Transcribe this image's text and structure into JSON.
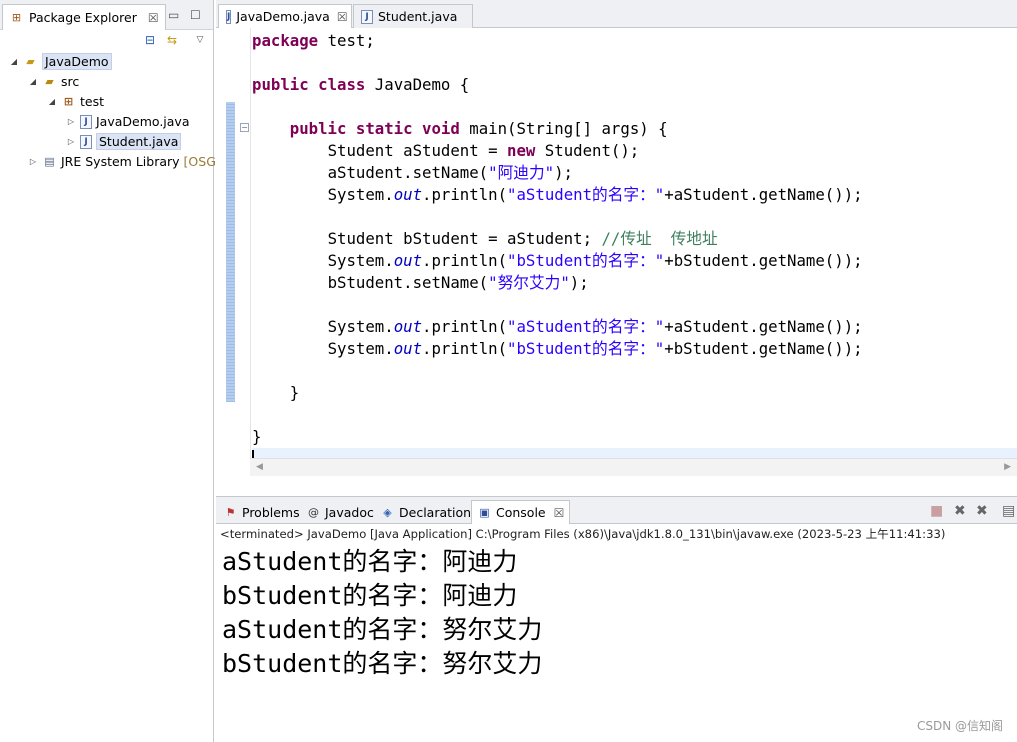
{
  "package_explorer": {
    "title": "Package Explorer",
    "close": "☒",
    "tree": {
      "project": "JavaDemo",
      "src": "src",
      "package": "test",
      "files": [
        "JavaDemo.java",
        "Student.java"
      ],
      "jre": "JRE System Library",
      "jre_decoration": "[OSGi"
    }
  },
  "editor": {
    "tabs": [
      {
        "label": "JavaDemo.java",
        "close": "☒"
      },
      {
        "label": "Student.java"
      }
    ],
    "code": {
      "l1_kw": "package",
      "l1_rest": " test;",
      "l3_kw1": "public",
      "l3_kw2": "class",
      "l3_rest": " JavaDemo {",
      "l5_kw1": "public",
      "l5_kw2": "static",
      "l5_kw3": "void",
      "l5_rest": " main(String[] args) {",
      "l6_a": "Student aStudent = ",
      "l6_kw": "new",
      "l6_b": " Student();",
      "l7_a": "aStudent.setName(",
      "l7_str": "\"阿迪力\"",
      "l7_b": ");",
      "sys": "System.",
      "out": "out",
      "println": ".println(",
      "l8_str": "\"aStudent的名字：\"",
      "l8_b": "+aStudent.getName());",
      "l10_a": "Student bStudent = aStudent; ",
      "l10_cmt": "//传址  传地址",
      "l11_str": "\"bStudent的名字：\"",
      "l11_b": "+bStudent.getName());",
      "l12_a": "bStudent.setName(",
      "l12_str": "\"努尔艾力\"",
      "l12_b": ");",
      "l14_str": "\"aStudent的名字：\"",
      "l14_b": "+aStudent.getName());",
      "l15_str": "\"bStudent的名字：\"",
      "l15_b": "+bStudent.getName());",
      "close_brace": "}"
    }
  },
  "bottom": {
    "tabs": [
      "Problems",
      "Javadoc",
      "Declaration",
      "Console"
    ],
    "console_close": "☒",
    "terminated": "<terminated> JavaDemo [Java Application] C:\\Program Files (x86)\\Java\\jdk1.8.0_131\\bin\\javaw.exe (2023-5-23 上午11:41:33)",
    "output": [
      "aStudent的名字：阿迪力",
      "bStudent的名字：阿迪力",
      "aStudent的名字：努尔艾力",
      "bStudent的名字：努尔艾力"
    ]
  },
  "watermark": "CSDN @信知阁",
  "colors": {
    "keyword": "#7f0055",
    "string": "#2a00ff",
    "static_field": "#0000c0",
    "comment": "#3f7f5f",
    "current_line": "#e8f2fe",
    "change_bar": "#b4cdee"
  }
}
